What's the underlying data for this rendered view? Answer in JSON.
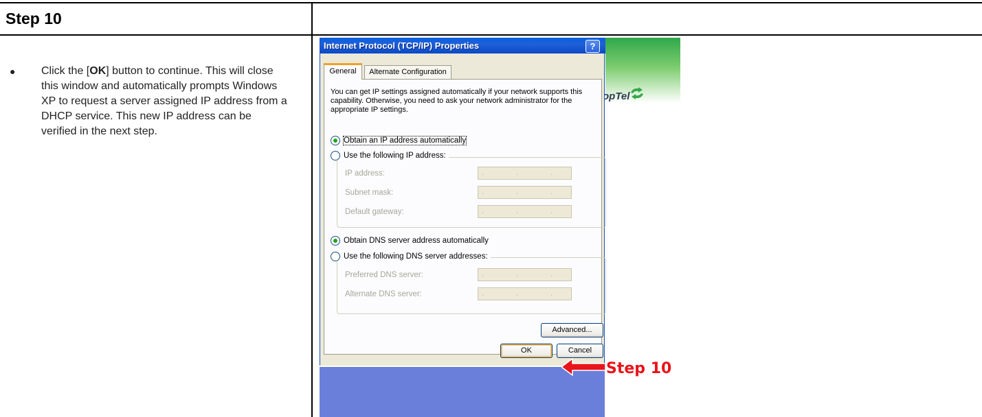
{
  "doc": {
    "step_title": "Step 10",
    "instruction_prefix": "Click the [",
    "instruction_bold": "OK",
    "instruction_suffix": "] button to continue. This will close this window and automatically prompts Windows XP to request a server assigned IP address from a DHCP service. This new IP address can be verified in the next step."
  },
  "dialog": {
    "title": "Internet Protocol (TCP/IP) Properties",
    "help_label": "?",
    "tabs": [
      {
        "label": "General",
        "active": true
      },
      {
        "label": "Alternate Configuration",
        "active": false
      }
    ],
    "description": "You can get IP settings assigned automatically if your network supports this capability. Otherwise, you need to ask your network administrator for the appropriate IP settings.",
    "ip_auto_label": "Obtain an IP address automatically",
    "ip_manual_label": "Use the following IP address:",
    "ip_fields": [
      {
        "label": "IP address:",
        "value": ". . ."
      },
      {
        "label": "Subnet mask:",
        "value": ". . ."
      },
      {
        "label": "Default gateway:",
        "value": ". . ."
      }
    ],
    "dns_auto_label": "Obtain DNS server address automatically",
    "dns_manual_label": "Use the following DNS server addresses:",
    "dns_fields": [
      {
        "label": "Preferred DNS server:",
        "value": ". . ."
      },
      {
        "label": "Alternate DNS server:",
        "value": ". . ."
      }
    ],
    "advanced_label": "Advanced...",
    "ok_label": "OK",
    "cancel_label": "Cancel"
  },
  "brand": {
    "name": "CoopTel",
    "gradient_top": "#2fa84a"
  },
  "callout": {
    "label": "Step 10",
    "color": "#e8141b"
  }
}
